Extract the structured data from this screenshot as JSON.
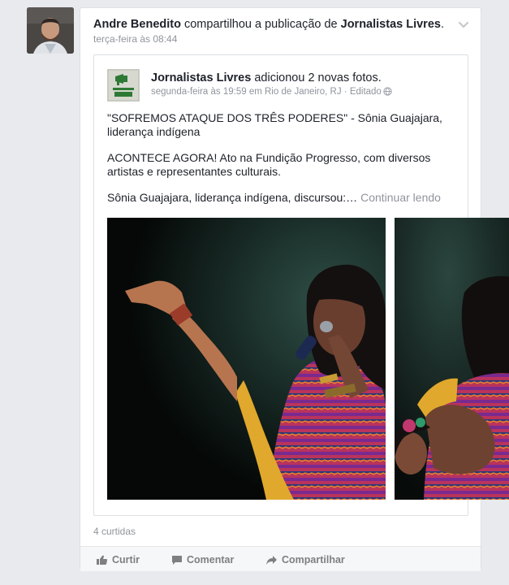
{
  "story": {
    "actor": "Andre Benedito",
    "verb": " compartilhou a publicação de ",
    "target": "Jornalistas Livres",
    "period": ".",
    "time": "terça-feira às 08:44"
  },
  "shared_post": {
    "page_name": "Jornalistas Livres",
    "action": " adicionou 2 novas fotos.",
    "time_location": "segunda-feira às 19:59 em Rio de Janeiro, RJ · Editado",
    "logo_text": "JORNALISTAS LIVRES",
    "paragraphs": [
      "\"SOFREMOS ATAQUE DOS TRÊS PODERES\" - Sônia Guajajara, liderança indígena",
      "ACONTECE AGORA! Ato na Fundição Progresso, com diversos artistas e representantes culturais."
    ],
    "excerpt": "Sônia Guajajara, liderança indígena, discursou:…",
    "continue_label": "Continuar lendo"
  },
  "likes": "4 curtidas",
  "actions": {
    "like": "Curtir",
    "comment": "Comentar",
    "share": "Compartilhar"
  },
  "colors": {
    "page_bg": "#e9eaed",
    "text": "#1d2129",
    "meta": "#90949c",
    "action": "#7f7f7f",
    "logo_green": "#2e7a35"
  },
  "icons": {
    "chevron": "chevron-down-icon",
    "globe": "globe-icon",
    "like": "thumbs-up-icon",
    "comment": "speech-bubble-icon",
    "share": "share-arrow-icon"
  }
}
